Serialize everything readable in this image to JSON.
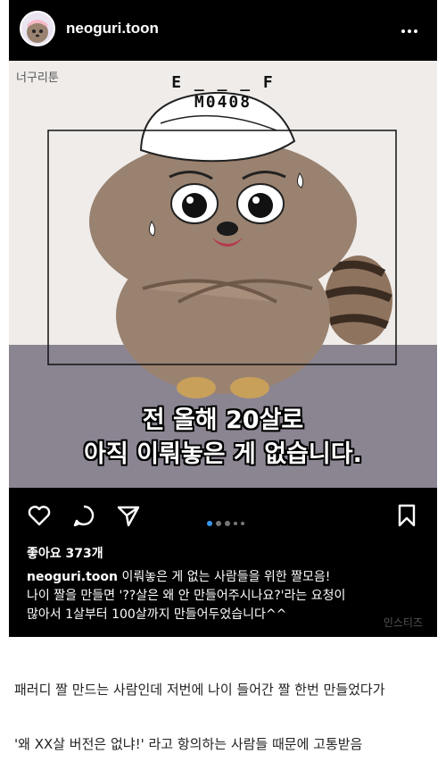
{
  "post": {
    "username": "neoguri.toon",
    "image": {
      "brand": "너구리툰",
      "code_top": "E _ _ _ F",
      "code_bottom": "M0408",
      "caption_line1": "전 올해 20살로",
      "caption_line2": "아직 이뤄놓은 게 없습니다."
    },
    "likes": "좋아요 373개",
    "caption": {
      "user": "neoguri.toon",
      "line1": "이뤄놓은 게 없는 사람들을 위한 짤모음!",
      "line2": "나이 짤을 만들면 '??살은 왜 안 만들어주시나요?'라는 요청이",
      "line3": "많아서 1살부터 100살까지 만들어두었습니다^^"
    },
    "watermark": "인스티즈",
    "carousel": {
      "count": 5,
      "active_index": 0
    },
    "icons": [
      "heart-icon",
      "comment-icon",
      "share-icon",
      "bookmark-icon",
      "more-icon"
    ]
  },
  "body": {
    "line1": "패러디 짤 만드는 사람인데 저번에 나이 들어간 짤 한번 만들었다가",
    "line2": "'왜 XX살 버전은 없냐!' 라고 항의하는 사람들 때문에 고통받음"
  },
  "colors": {
    "post_bg": "#000000",
    "accent": "#3897f0",
    "raccoon": "#9a8270"
  }
}
